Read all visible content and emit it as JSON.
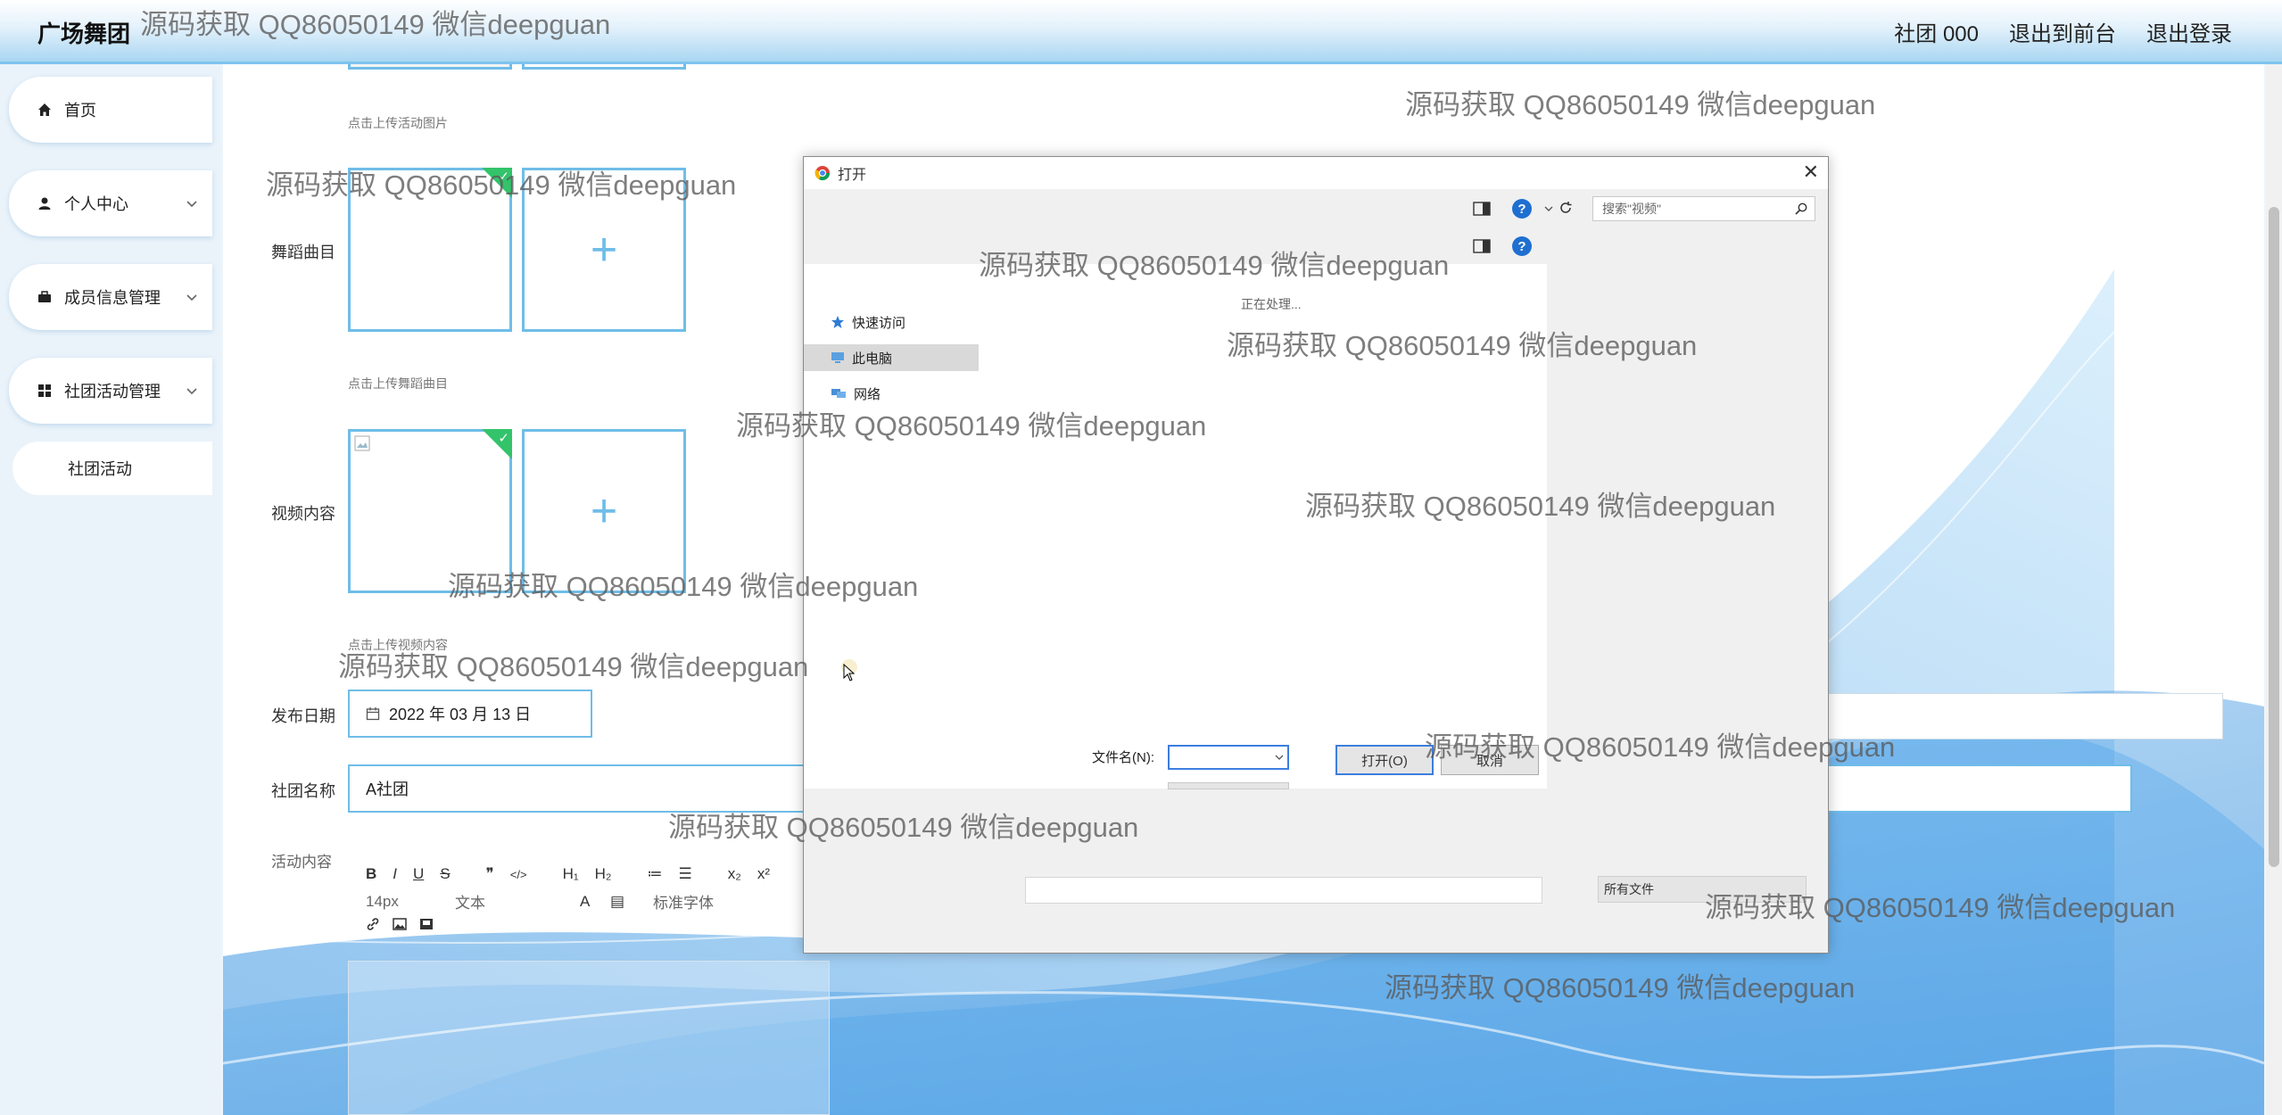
{
  "header": {
    "brand": "广场舞团",
    "nav": [
      "社团 000",
      "退出到前台",
      "退出登录"
    ]
  },
  "sidebar": {
    "items": [
      {
        "label": "首页",
        "icon": "home-icon"
      },
      {
        "label": "个人中心",
        "icon": "user-icon"
      },
      {
        "label": "成员信息管理",
        "icon": "briefcase-icon"
      },
      {
        "label": "社团活动管理",
        "icon": "grid-icon"
      }
    ],
    "subitem": "社团活动"
  },
  "form": {
    "hint_activity_image": "点击上传活动图片",
    "label_dance_track": "舞蹈曲目",
    "hint_dance_track": "点击上传舞蹈曲目",
    "label_video": "视频内容",
    "hint_video": "点击上传视频内容",
    "label_date": "发布日期",
    "date_value": "2022 年 03 月 13 日",
    "label_club": "社团名称",
    "club_value": "A社团",
    "label_content": "活动内容",
    "upload_plus": "+",
    "editor": {
      "row1": [
        "B",
        "I",
        "U",
        "S",
        "❞",
        "</>",
        "H₁",
        "H₂",
        "≔",
        "☰",
        "x₂",
        "x²"
      ],
      "font_size": "14px",
      "text_style": "文本",
      "font_family": "标准字体"
    }
  },
  "dialog": {
    "title": "打开",
    "search_placeholder": "搜索\"视频\"",
    "nav_items": [
      "快速访问",
      "此电脑",
      "网络"
    ],
    "processing": "正在处理...",
    "filename_label": "文件名(N):",
    "open_button": "打开(O)",
    "cancel_button": "取消",
    "filetype": "所有文件",
    "help_symbol": "?",
    "close_symbol": "✕"
  },
  "watermark": "源码获取 QQ86050149 微信deepguan"
}
